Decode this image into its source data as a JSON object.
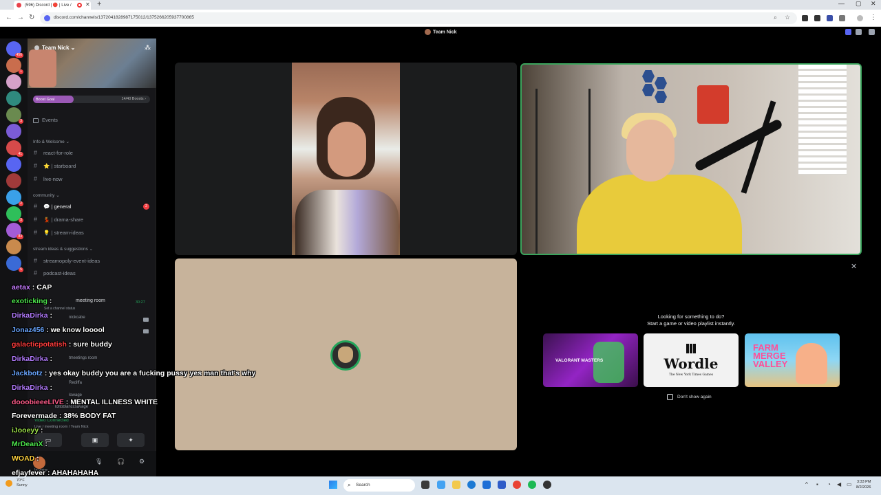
{
  "browser": {
    "tab_title": "(596) Discord | 🔴 | Live /",
    "url": "discord.com/channels/1372041828987175012/1375266205937700865"
  },
  "discord": {
    "window_title": "Team Nick",
    "server": {
      "name": "Team Nick",
      "boost_label": "Boost Goal",
      "boost_count": "14/40 Boosts",
      "boost_progress": 0.35
    },
    "events_label": "Events",
    "categories": [
      {
        "name": "Info & Welcome"
      },
      {
        "name": "community"
      },
      {
        "name": "stream ideas & suggestions"
      }
    ],
    "channels": {
      "info": [
        "react-for-role",
        "⭐ | starboard",
        "live-now"
      ],
      "community": [
        "💬 | general",
        "💃 | drama-share",
        "💡 | stream-ideas"
      ],
      "stream_ideas": [
        "streamopoly-event-ideas",
        "podcast-ideas"
      ]
    },
    "general_badge": "2",
    "voice": {
      "room_label": "meeting room",
      "room_timer": "30:27",
      "set_status": "Set a channel status",
      "rows": [
        "nickcabe",
        "tmeetings room",
        "Rediffa",
        "lowage",
        "lottoblanccsavage"
      ],
      "connected": "Video Connected",
      "connected_sub": "Live / meeting room / Team Nick"
    },
    "user_status": "In voice"
  },
  "stage": {
    "activity_prompt_line1": "Looking for something to do?",
    "activity_prompt_line2": "Start a game or video playlist instantly.",
    "activities": [
      {
        "name": "VALORANT MASTERS"
      },
      {
        "name": "Wordle",
        "sub": "The New York Times Games"
      },
      {
        "name": "FARM MERGE VALLEY"
      }
    ],
    "dont_show": "Don't show again"
  },
  "chat": [
    {
      "user": "aetax",
      "text": "CAP",
      "color": "#c77dff"
    },
    {
      "user": "exoticking",
      "text": "",
      "color": "#4ce44c"
    },
    {
      "user": "DirkaDirka",
      "text": "",
      "color": "#b47cff"
    },
    {
      "user": "Jonaz456",
      "text": "we know looool",
      "color": "#6aa6ff"
    },
    {
      "user": "galacticpotatish",
      "text": "sure buddy",
      "color": "#ff3d3d"
    },
    {
      "user": "DirkaDirka",
      "text": "",
      "color": "#b47cff"
    },
    {
      "user": "Jackbotz",
      "text": "yes okay buddy you are a fucking pussy yes man that's why",
      "color": "#6aa6ff"
    },
    {
      "user": "DirkaDirka",
      "text": "",
      "color": "#b47cff"
    },
    {
      "user": "dooobieeeLIVE",
      "text": "MENTAL ILLNESS WHITE",
      "color": "#ff5c8a"
    },
    {
      "user": "Forevermade",
      "text": "38% BODY FAT",
      "color": "#ffffff"
    },
    {
      "user": "iJooeyy",
      "text": "",
      "color": "#9fe34b"
    },
    {
      "user": "MrDeanX",
      "text": "",
      "color": "#4ce44c"
    },
    {
      "user": "WOAD",
      "text": "",
      "color": "#ffd23f"
    },
    {
      "user": "efjayfever",
      "text": "AHAHAHAHA",
      "color": "#ffffff"
    }
  ],
  "taskbar": {
    "weather_temp": "70°F",
    "weather_desc": "Sunny",
    "search_label": "Search",
    "time": "3:33 PM",
    "date": "8/2/2026"
  },
  "rail_badges": [
    "456",
    "1",
    "",
    "",
    "3",
    "",
    "41",
    "",
    "",
    "2",
    "3",
    "83",
    "",
    "5"
  ]
}
